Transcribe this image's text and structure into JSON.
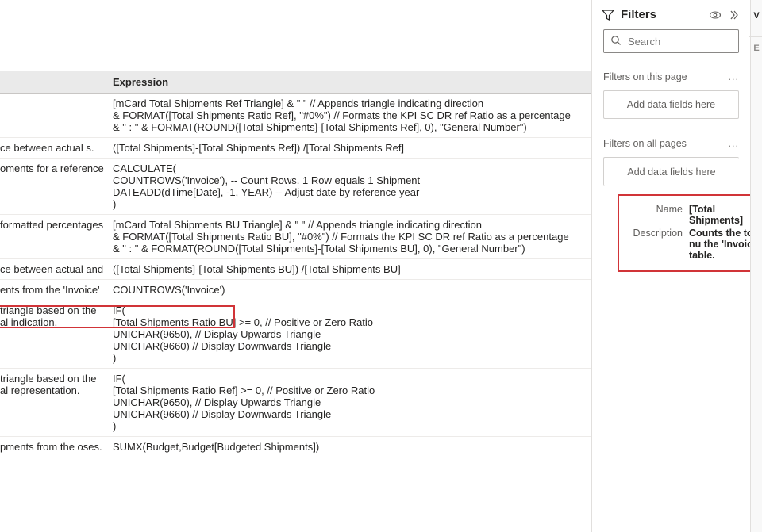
{
  "table": {
    "header": {
      "desc": "",
      "expr": "Expression"
    },
    "rows": [
      {
        "desc": "",
        "expr": "[mCard Total Shipments Ref Triangle] & \" \" // Appends triangle indicating direction\n& FORMAT([Total Shipments Ratio Ref], \"#0%\") // Formats the KPI SC DR ref Ratio as a percentage\n& \" : \" & FORMAT(ROUND([Total Shipments]-[Total Shipments Ref], 0), \"General Number\")"
      },
      {
        "desc": "ce between actual\ns.",
        "expr": "([Total Shipments]-[Total Shipments Ref]) /[Total Shipments Ref]"
      },
      {
        "desc": "oments for a reference",
        "expr": "CALCULATE(\nCOUNTROWS('Invoice'), -- Count Rows. 1 Row equals 1 Shipment\nDATEADD(dTime[Date], -1, YEAR) -- Adjust date by reference year\n)"
      },
      {
        "desc": " formatted percentages",
        "expr": "[mCard Total Shipments BU Triangle] & \" \" // Appends triangle indicating direction\n& FORMAT([Total Shipments Ratio BU], \"#0%\") // Formats the KPI SC DR ref Ratio as a percentage\n& \" : \" & FORMAT(ROUND([Total Shipments]-[Total Shipments BU], 0), \"General Number\")"
      },
      {
        "desc": "ce between actual and",
        "expr": "([Total Shipments]-[Total Shipments BU]) /[Total Shipments BU]"
      },
      {
        "desc": "ents from the 'Invoice'",
        "expr": "COUNTROWS('Invoice')"
      },
      {
        "desc": "triangle based on the\nal indication.",
        "expr": "IF(\n[Total Shipments Ratio BU] >= 0, // Positive or Zero Ratio\nUNICHAR(9650), // Display Upwards Triangle\nUNICHAR(9660) // Display Downwards Triangle\n)"
      },
      {
        "desc": "triangle based on the\nal representation.",
        "expr": "IF(\n[Total Shipments Ratio Ref] >= 0, // Positive or Zero Ratio\nUNICHAR(9650), // Display Upwards Triangle\nUNICHAR(9660) // Display Downwards Triangle\n)"
      },
      {
        "desc": "pments from the\noses.",
        "expr": "SUMX(Budget,Budget[Budgeted Shipments])"
      }
    ]
  },
  "filters": {
    "title": "Filters",
    "search_placeholder": "Search",
    "section1": "Filters on this page",
    "dropzone": "Add data fields here",
    "section2": "Filters on all pages",
    "more": "..."
  },
  "tooltip": {
    "name_label": "Name",
    "name_value": "[Total Shipments]",
    "desc_label": "Description",
    "desc_value": "Counts the total nu\nthe 'Invoice' table."
  },
  "right_strip": {
    "v": "V",
    "e": "E"
  }
}
